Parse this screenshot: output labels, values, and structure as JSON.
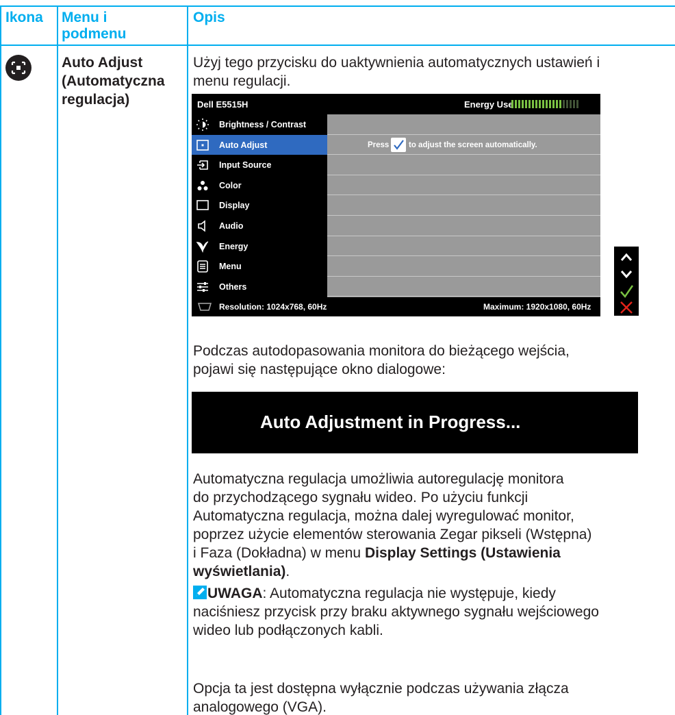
{
  "table": {
    "headers": [
      "Ikona",
      "Menu i podmenu",
      "Opis"
    ],
    "header_menu_line1": "Menu i",
    "header_menu_line2": "podmenu"
  },
  "row": {
    "icon_name": "auto-adjust-icon",
    "menu_line1": "Auto Adjust",
    "menu_line2": "(Automatyczna",
    "menu_line3": "regulacja)",
    "intro_line1": "Użyj tego przycisku do uaktywnienia automatycznych ustawień i",
    "intro_line2": "menu regulacji.",
    "dialog_intro_line1": "Podczas autodopasowania monitora do bieżącego wejścia,",
    "dialog_intro_line2": "pojawi się następujące okno dialogowe:",
    "dialog_text": "Auto Adjustment in Progress...",
    "desc_line1": "Automatyczna regulacja umożliwia autoregulację monitora",
    "desc_line2": "do przychodzącego sygnału wideo. Po użyciu funkcji",
    "desc_line3": "Automatyczna regulacja, można dalej wyregulować monitor,",
    "desc_line4": "poprzez użycie elementów sterowania Zegar pikseli (Wstępna)",
    "desc_line5_prefix": "i Faza (Dokładna) w menu ",
    "desc_line5_bold": "Display Settings (Ustawienia",
    "desc_line6_bold": "wyświetlania)",
    "desc_line6_suffix": ".",
    "note_label": "UWAGA",
    "note_line1": ": Automatyczna regulacja nie występuje, kiedy",
    "note_line2": "naciśniesz przycisk przy braku aktywnego sygnału wejściowego",
    "note_line3": "wideo lub podłączonych kabli.",
    "option_line1": "Opcja ta jest dostępna wyłącznie podczas używania złącza",
    "option_line2": "analogowego (VGA)."
  },
  "osd": {
    "model": "Dell E5515H",
    "energy_label": "Energy Use",
    "energy_level_bars": 15,
    "energy_total_bars": 20,
    "menu_items": [
      {
        "label": "Brightness / Contrast",
        "icon": "brightness-icon"
      },
      {
        "label": "Auto Adjust",
        "icon": "auto-adjust-icon",
        "selected": true
      },
      {
        "label": "Input Source",
        "icon": "input-source-icon"
      },
      {
        "label": "Color",
        "icon": "color-icon"
      },
      {
        "label": "Display",
        "icon": "display-icon"
      },
      {
        "label": "Audio",
        "icon": "audio-icon"
      },
      {
        "label": "Energy",
        "icon": "energy-icon"
      },
      {
        "label": "Menu",
        "icon": "menu-icon"
      },
      {
        "label": "Others",
        "icon": "others-icon"
      }
    ],
    "press_prefix": "Press",
    "press_suffix": "to adjust the screen automatically.",
    "resolution": "Resolution: 1024x768, 60Hz",
    "maximum": "Maximum: 1920x1080, 60Hz",
    "side_buttons": [
      "up-arrow-icon",
      "down-arrow-icon",
      "check-icon",
      "close-icon"
    ],
    "colors": {
      "selected": "#2f6ac0",
      "panel": "#9a9a9a",
      "energy_on": "#7ac143",
      "energy_off": "#6d8a5a",
      "check": "#7ac143",
      "close": "#e2231a"
    }
  }
}
